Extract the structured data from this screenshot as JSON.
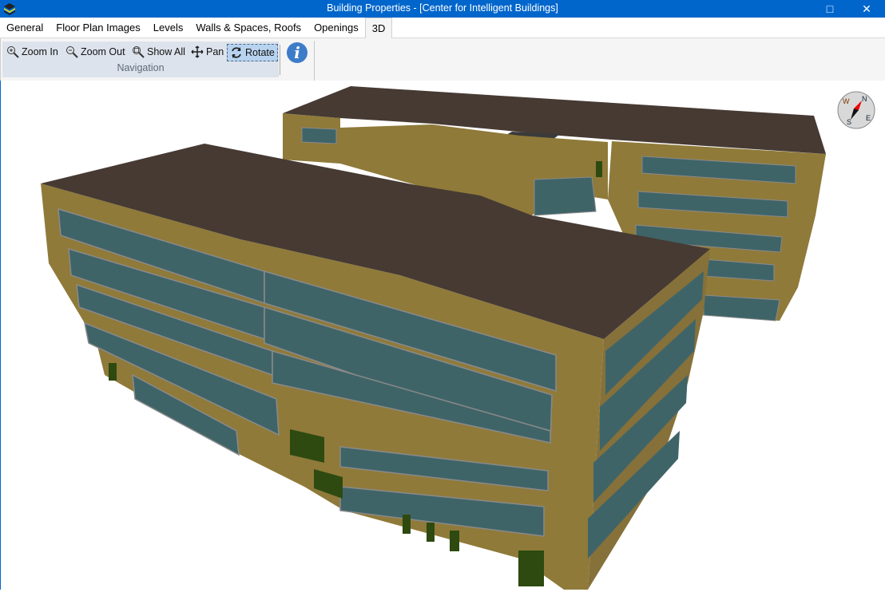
{
  "window": {
    "title": "Building Properties - [Center for Intelligent Buildings]",
    "maximize_icon": "□",
    "close_icon": "✕"
  },
  "tabs": [
    {
      "label": "General"
    },
    {
      "label": "Floor Plan Images"
    },
    {
      "label": "Levels"
    },
    {
      "label": "Walls & Spaces, Roofs"
    },
    {
      "label": "Openings"
    },
    {
      "label": "3D",
      "active": true
    }
  ],
  "toolbar": {
    "group_label": "Navigation",
    "buttons": [
      {
        "label": "Zoom In",
        "icon": "zoom-in-icon"
      },
      {
        "label": "Zoom Out",
        "icon": "zoom-out-icon"
      },
      {
        "label": "Show All",
        "icon": "show-all-icon"
      },
      {
        "label": "Pan",
        "icon": "pan-icon"
      },
      {
        "label": "Rotate",
        "icon": "rotate-icon",
        "active": true
      }
    ],
    "info_label": "i"
  },
  "compass": {
    "n": "N",
    "s": "S",
    "e": "E",
    "w": "W"
  },
  "colors": {
    "titlebar": "#0066cc",
    "wall": "#8f7a3a",
    "roof": "#463a33",
    "window": "#3f6468",
    "door": "#2e4a10"
  }
}
